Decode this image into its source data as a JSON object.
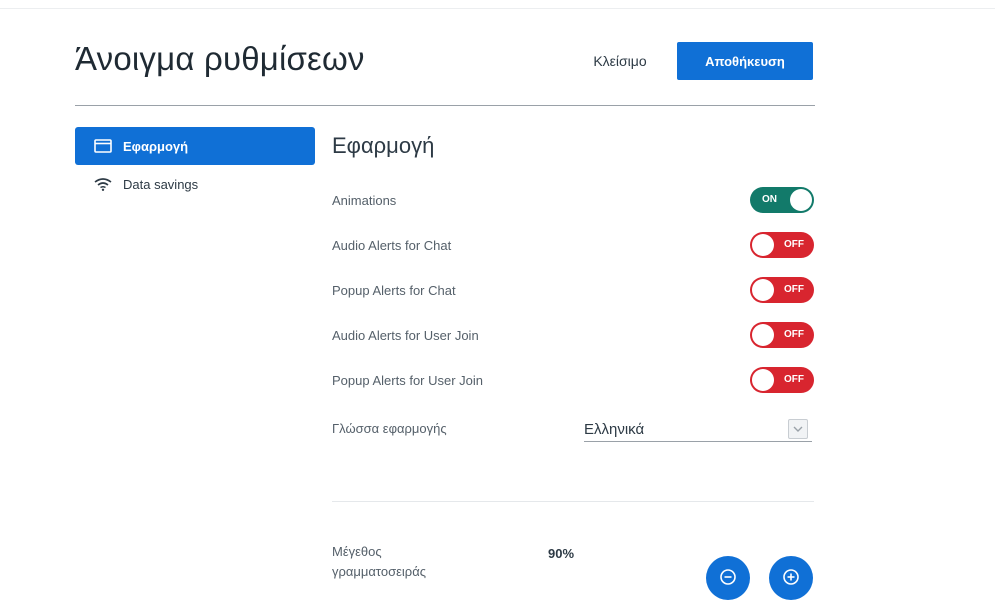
{
  "header": {
    "title": "Άνοιγμα ρυθμίσεων",
    "close_label": "Κλείσιμο",
    "save_label": "Αποθήκευση"
  },
  "sidebar": {
    "items": [
      {
        "label": "Εφαρμογή",
        "icon": "window-icon",
        "active": true
      },
      {
        "label": "Data savings",
        "icon": "wifi-icon",
        "active": false
      }
    ]
  },
  "content": {
    "section_title": "Εφαρμογή",
    "settings": [
      {
        "label": "Animations",
        "state": "ON"
      },
      {
        "label": "Audio Alerts for Chat",
        "state": "OFF"
      },
      {
        "label": "Popup Alerts for Chat",
        "state": "OFF"
      },
      {
        "label": "Audio Alerts for User Join",
        "state": "OFF"
      },
      {
        "label": "Popup Alerts for User Join",
        "state": "OFF"
      }
    ],
    "language": {
      "label": "Γλώσσα εφαρμογής",
      "value": "Ελληνικά"
    },
    "font_size": {
      "label": "Μέγεθος γραμματοσειράς",
      "value": "90%",
      "decrease_icon": "minus-circle-icon",
      "increase_icon": "plus-circle-icon"
    }
  },
  "colors": {
    "accent": "#1070d6",
    "toggle_on": "#127a6a",
    "toggle_off": "#d8252f"
  }
}
